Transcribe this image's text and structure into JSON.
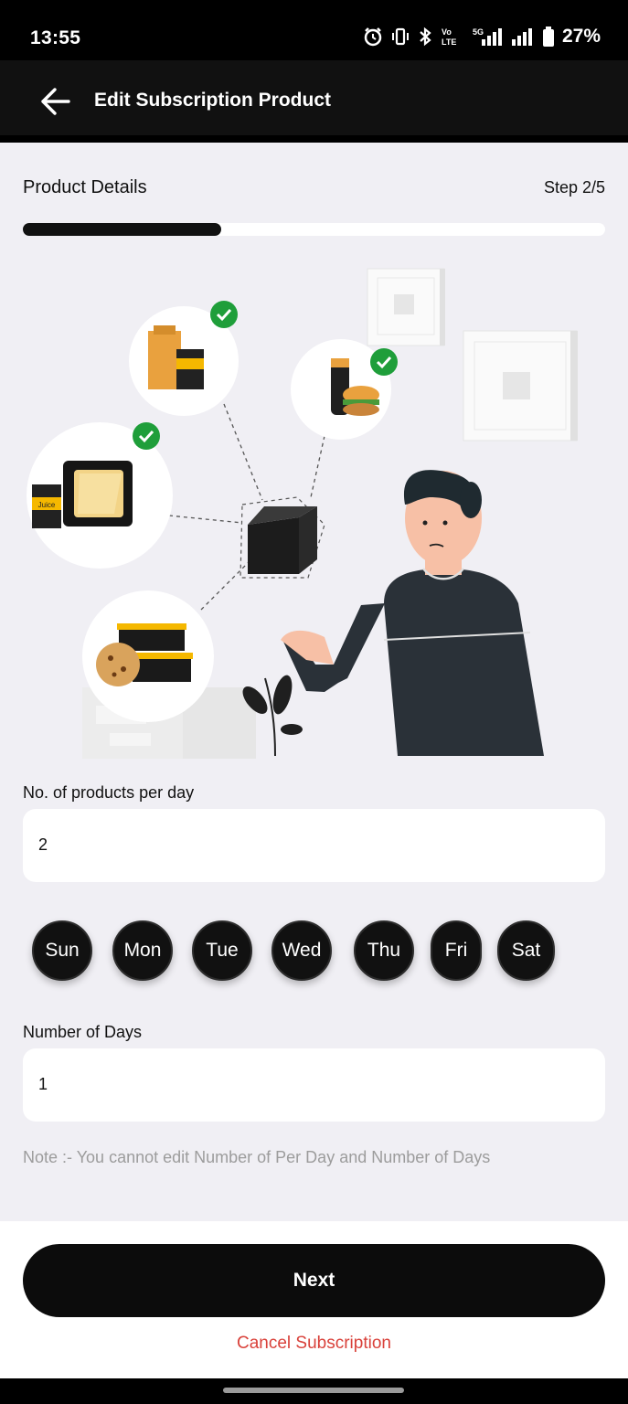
{
  "status_bar": {
    "time": "13:55",
    "battery": "27%",
    "icons": [
      "alarm-icon",
      "vibrate-icon",
      "bluetooth-icon",
      "volte-icon",
      "5g-signal-icon",
      "signal-icon",
      "battery-icon"
    ],
    "volte_text": "Vo\nLTE",
    "net_text": "5G"
  },
  "app_bar": {
    "back_icon": "arrow-left-icon",
    "title": "Edit Subscription Product"
  },
  "header": {
    "section_title": "Product Details",
    "step": "Step 2/5",
    "progress": 0.34
  },
  "illustration": {
    "juice_label": "Juice"
  },
  "products_per_day": {
    "label": "No. of products per day",
    "value": "2"
  },
  "days": [
    "Sun",
    "Mon",
    "Tue",
    "Wed",
    "Thu",
    "Fri",
    "Sat"
  ],
  "number_of_days": {
    "label": "Number of Days",
    "value": "1"
  },
  "note": "Note :- You cannot edit Number of Per Day and Number of Days",
  "actions": {
    "next": "Next",
    "cancel": "Cancel Subscription"
  },
  "colors": {
    "background": "#f0eff4",
    "primary": "#111111",
    "cancel": "#d9413a",
    "check": "#1f9e3a",
    "accent_yellow": "#f5b800"
  }
}
